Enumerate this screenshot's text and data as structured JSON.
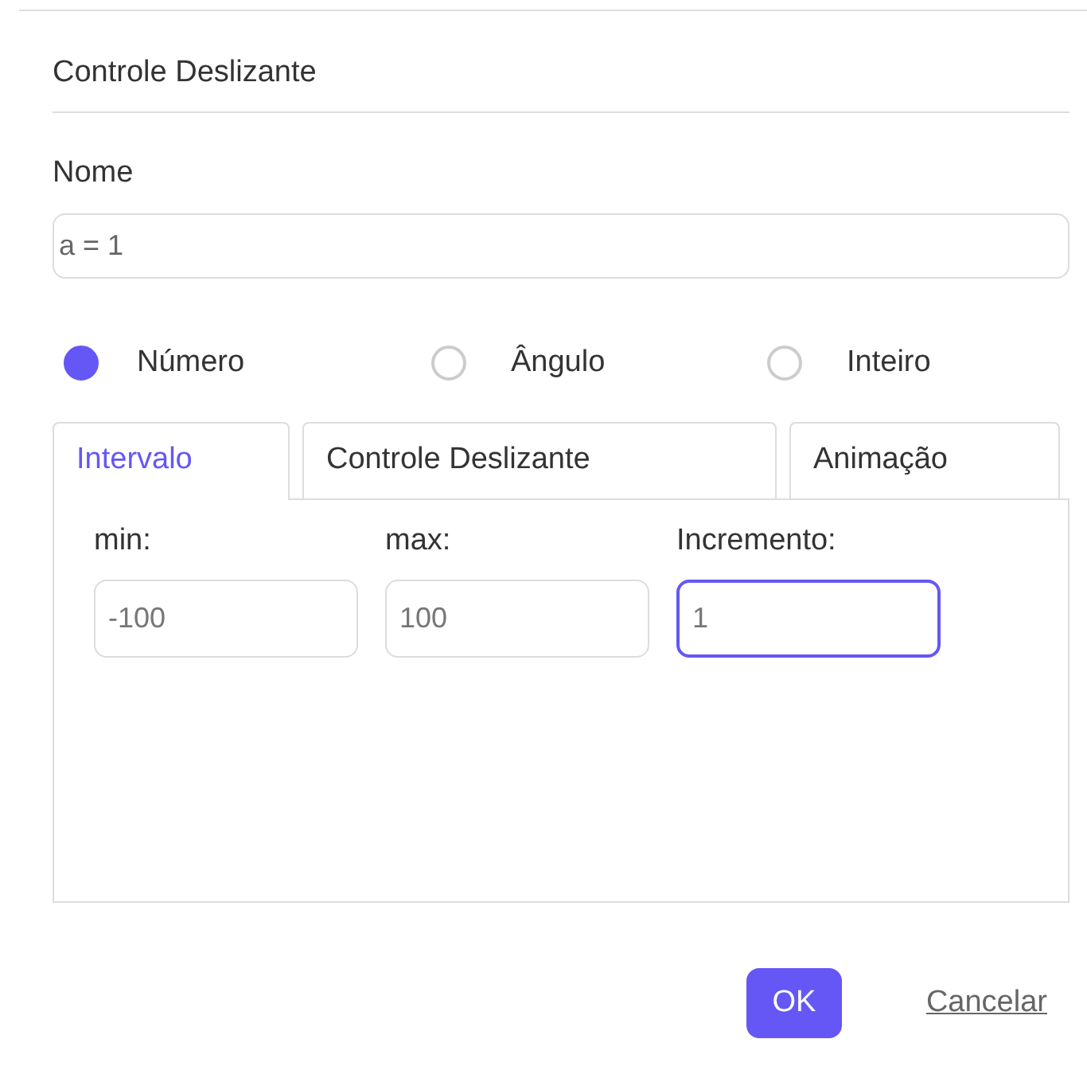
{
  "dialog": {
    "title": "Controle Deslizante"
  },
  "name_field": {
    "label": "Nome",
    "value": "a = 1"
  },
  "types": [
    {
      "label": "Número",
      "selected": true
    },
    {
      "label": "Ângulo",
      "selected": false
    },
    {
      "label": "Inteiro",
      "selected": false
    }
  ],
  "tabs": [
    {
      "label": "Intervalo",
      "selected": true
    },
    {
      "label": "Controle Deslizante",
      "selected": false
    },
    {
      "label": "Animação",
      "selected": false
    }
  ],
  "fields": [
    {
      "label": "min:",
      "value": "-100",
      "focused": false
    },
    {
      "label": "max:",
      "value": "100",
      "focused": false
    },
    {
      "label": "Incremento:",
      "value": "1",
      "focused": true
    }
  ],
  "buttons": {
    "ok": "OK",
    "cancel": "Cancelar"
  }
}
